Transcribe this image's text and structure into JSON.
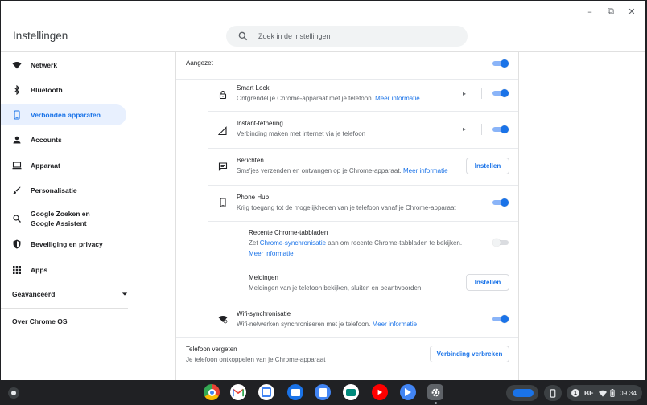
{
  "app": {
    "title": "Instellingen"
  },
  "window_controls": {
    "minimize": "–",
    "restore": "⧉",
    "close": "✕"
  },
  "search": {
    "placeholder": "Zoek in de instellingen"
  },
  "sidebar": {
    "items": [
      {
        "label": "Netwerk",
        "icon": "wifi-icon"
      },
      {
        "label": "Bluetooth",
        "icon": "bluetooth-icon"
      },
      {
        "label": "Verbonden apparaten",
        "icon": "phone-icon",
        "active": true
      },
      {
        "label": "Accounts",
        "icon": "person-icon"
      },
      {
        "label": "Apparaat",
        "icon": "laptop-icon"
      },
      {
        "label": "Personalisatie",
        "icon": "brush-icon"
      },
      {
        "label": "Google Zoeken en Google Assistent",
        "icon": "search-icon"
      },
      {
        "label": "Beveiliging en privacy",
        "icon": "shield-icon"
      },
      {
        "label": "Apps",
        "icon": "apps-grid-icon"
      }
    ],
    "advanced": "Geavanceerd",
    "about": "Over Chrome OS"
  },
  "main": {
    "enabled": {
      "label": "Aangezet",
      "on": true
    },
    "smart_lock": {
      "title": "Smart Lock",
      "desc": "Ontgrendel je Chrome-apparaat met je telefoon.",
      "link": "Meer informatie",
      "on": true
    },
    "tethering": {
      "title": "Instant-tethering",
      "desc": "Verbinding maken met internet via je telefoon",
      "on": true
    },
    "messages": {
      "title": "Berichten",
      "desc": "Sms'jes verzenden en ontvangen op je Chrome-apparaat.",
      "link": "Meer informatie",
      "button": "Instellen"
    },
    "phone_hub": {
      "title": "Phone Hub",
      "desc": "Krijg toegang tot de mogelijkheden van je telefoon vanaf je Chrome-apparaat",
      "on": true
    },
    "recent_tabs": {
      "title": "Recente Chrome-tabbladen",
      "desc_pre": "Zet",
      "desc_link": "Chrome-synchronisatie",
      "desc_post": "aan om recente Chrome-tabbladen te bekijken.",
      "link": "Meer informatie",
      "on": false
    },
    "notifications": {
      "title": "Meldingen",
      "desc": "Meldingen van je telefoon bekijken, sluiten en beantwoorden",
      "button": "Instellen"
    },
    "wifi_sync": {
      "title": "Wifi-synchronisatie",
      "desc": "Wifi-netwerken synchroniseren met je telefoon.",
      "link": "Meer informatie",
      "on": true
    },
    "forget": {
      "title": "Telefoon vergeten",
      "desc": "Je telefoon ontkoppelen van je Chrome-apparaat",
      "button": "Verbinding verbreken"
    }
  },
  "shelf": {
    "apps": [
      "chrome-icon",
      "gmail-icon",
      "calendar-icon",
      "files-icon",
      "docs-icon",
      "meet-icon",
      "youtube-icon",
      "play-icon",
      "settings-icon"
    ],
    "tray": {
      "keyboard": "BE",
      "time": "09:34",
      "badge": "1"
    }
  },
  "colors": {
    "accent": "#1a73e8",
    "active_bg": "#e8f0fe",
    "shelf": "#202124"
  }
}
